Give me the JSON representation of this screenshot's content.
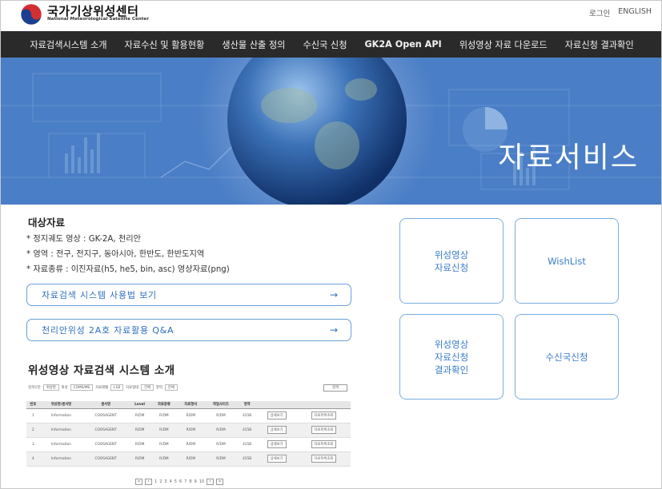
{
  "header": {
    "logo_title": "국가기상위성센터",
    "logo_subtitle": "National Meteorological Satellite Center",
    "links": [
      "로그인",
      "ENGLISH"
    ]
  },
  "nav": {
    "items": [
      "자료검색시스템 소개",
      "자료수신 및 활용현황",
      "생산물 산출 정의",
      "수신국 신청",
      "GK2A Open API",
      "위성영상 자료 다운로드",
      "자료신청 결과확인"
    ]
  },
  "hero": {
    "title": "자료서비스"
  },
  "target": {
    "title": "대상자료",
    "bullets": [
      "정지궤도 영상 : GK-2A, 천리안",
      "영역 : 전구, 전지구, 동아시아, 한반도, 한반도지역",
      "자료종류 : 이진자료(h5, he5, bin, asc) 영상자료(png)"
    ]
  },
  "buttons": {
    "guide": "자료검색 시스템 사용법 보기",
    "qa": "천리안위성 2A호 자료활용 Q&A"
  },
  "intro": {
    "title": "위성영상 자료검색 시스템 소개"
  },
  "tiles": {
    "request": "위성영상\n자료신청",
    "wishlist": "WishList",
    "result": "위성영상\n자료신청\n결과확인",
    "station": "수신국신청"
  },
  "mini": {
    "filters": [
      "검색구분",
      "위성명",
      "위성",
      "COMS/MS",
      "자료레벨",
      "L1B",
      "자료형태",
      "전체",
      "영역",
      "전체"
    ],
    "search": "검색",
    "headers": [
      "번호",
      "위성명/센서명",
      "센서명",
      "Level",
      "자료종류",
      "자료형식",
      "파일사이즈",
      "영역",
      "",
      ""
    ],
    "rows": [
      [
        "1",
        "Information",
        "COOSAGENT",
        "R/DM",
        "R/DM",
        "R/DM",
        "R/DM",
        "415B",
        "상세보기",
        "자료목록조회"
      ],
      [
        "2",
        "Information",
        "COOSAGENT",
        "R/DM",
        "R/DM",
        "R/DM",
        "R/DM",
        "415B",
        "상세보기",
        "자료목록조회"
      ],
      [
        "3",
        "Information",
        "COOSAGENT",
        "R/DM",
        "R/DM",
        "R/DM",
        "R/DM",
        "415B",
        "상세보기",
        "자료목록조회"
      ],
      [
        "4",
        "Information",
        "COOSAGENT",
        "R/DM",
        "R/DM",
        "R/DM",
        "R/DM",
        "415B",
        "상세보기",
        "자료목록조회"
      ]
    ],
    "pages": [
      "1",
      "2",
      "3",
      "4",
      "5",
      "6",
      "7",
      "8",
      "9",
      "10"
    ]
  },
  "colors": {
    "nav_bg": "#2a2a2a",
    "accent_blue": "#3a7cc8",
    "hero_blue": "#4c80c8"
  }
}
